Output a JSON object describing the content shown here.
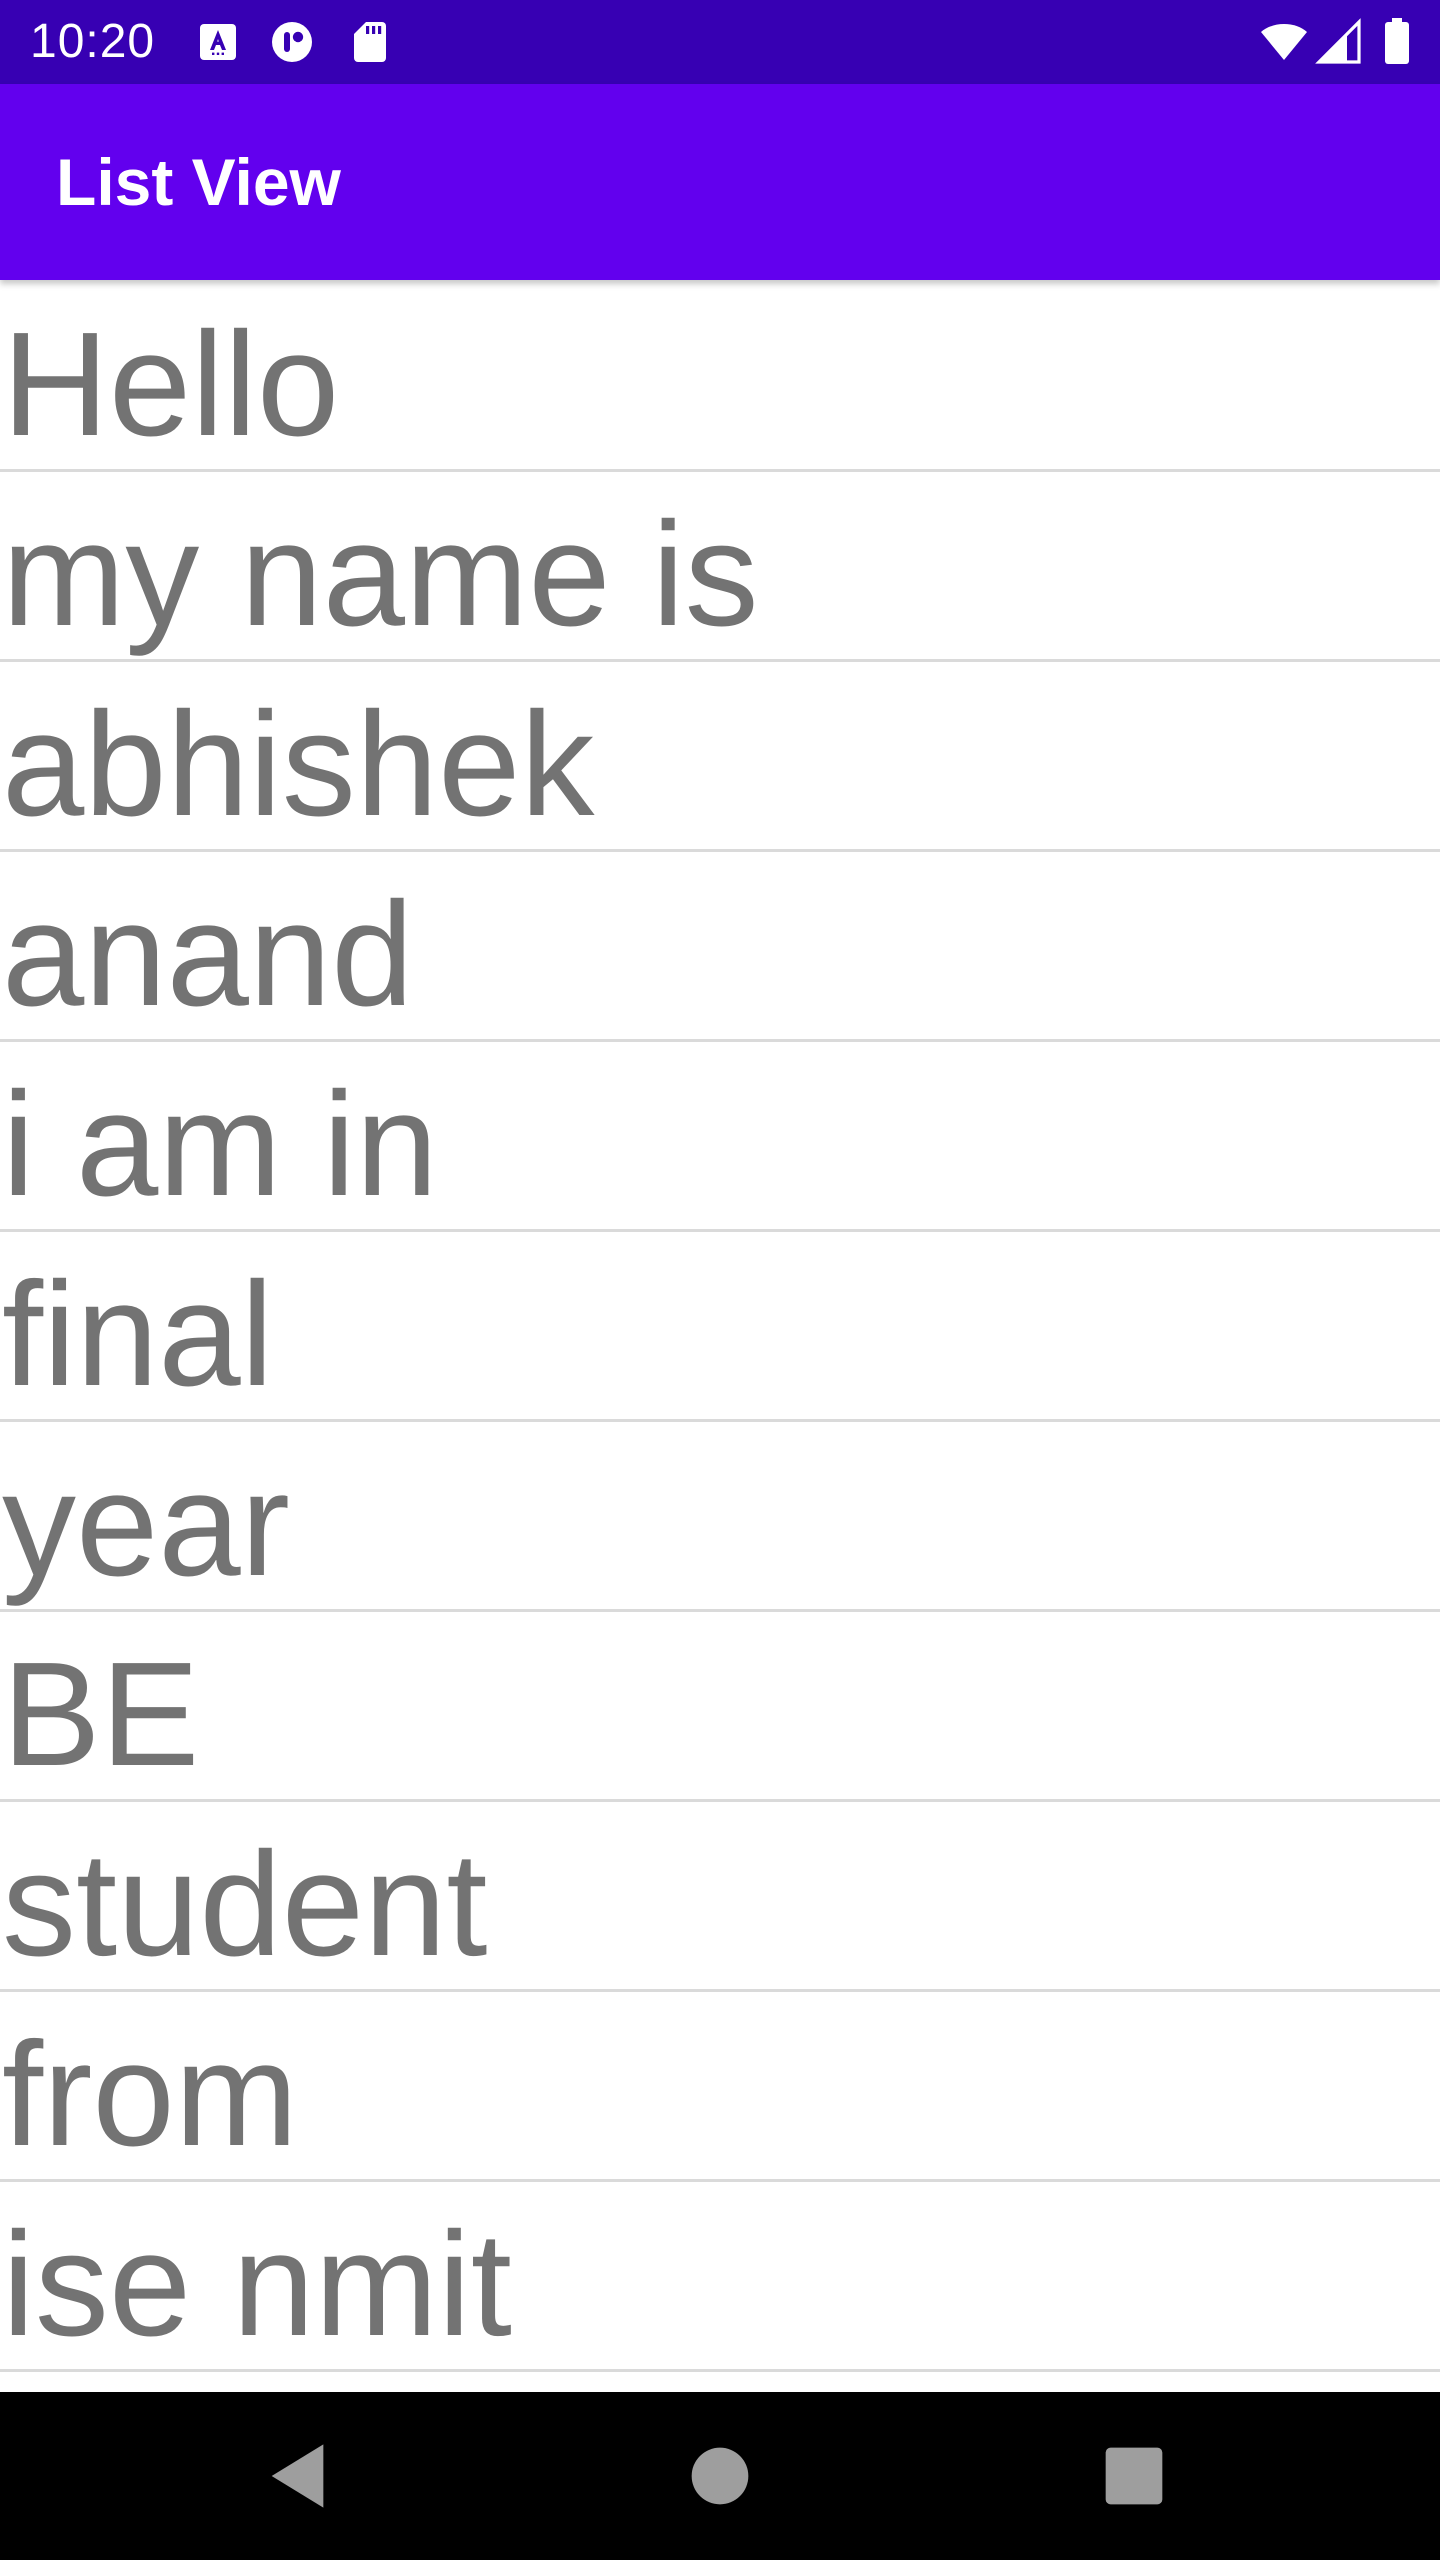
{
  "status_bar": {
    "time": "10:20",
    "left_icons": [
      "font-download-icon",
      "notification-circle-icon",
      "sd-card-icon"
    ],
    "right_icons": [
      "wifi-icon",
      "cell-signal-icon",
      "battery-icon"
    ],
    "background": "#3700B3"
  },
  "app_bar": {
    "title": "List View",
    "background": "#6200EE"
  },
  "list": {
    "items": [
      {
        "label": "Hello"
      },
      {
        "label": "my name is"
      },
      {
        "label": "abhishek"
      },
      {
        "label": "anand"
      },
      {
        "label": "i am in"
      },
      {
        "label": "final"
      },
      {
        "label": "year"
      },
      {
        "label": "BE"
      },
      {
        "label": "student"
      },
      {
        "label": "from"
      },
      {
        "label": "ise nmit"
      }
    ],
    "text_color": "#737373",
    "divider_color": "#dadada"
  },
  "nav_bar": {
    "buttons": [
      "back-icon",
      "home-icon",
      "recents-icon"
    ],
    "background": "#000000"
  }
}
